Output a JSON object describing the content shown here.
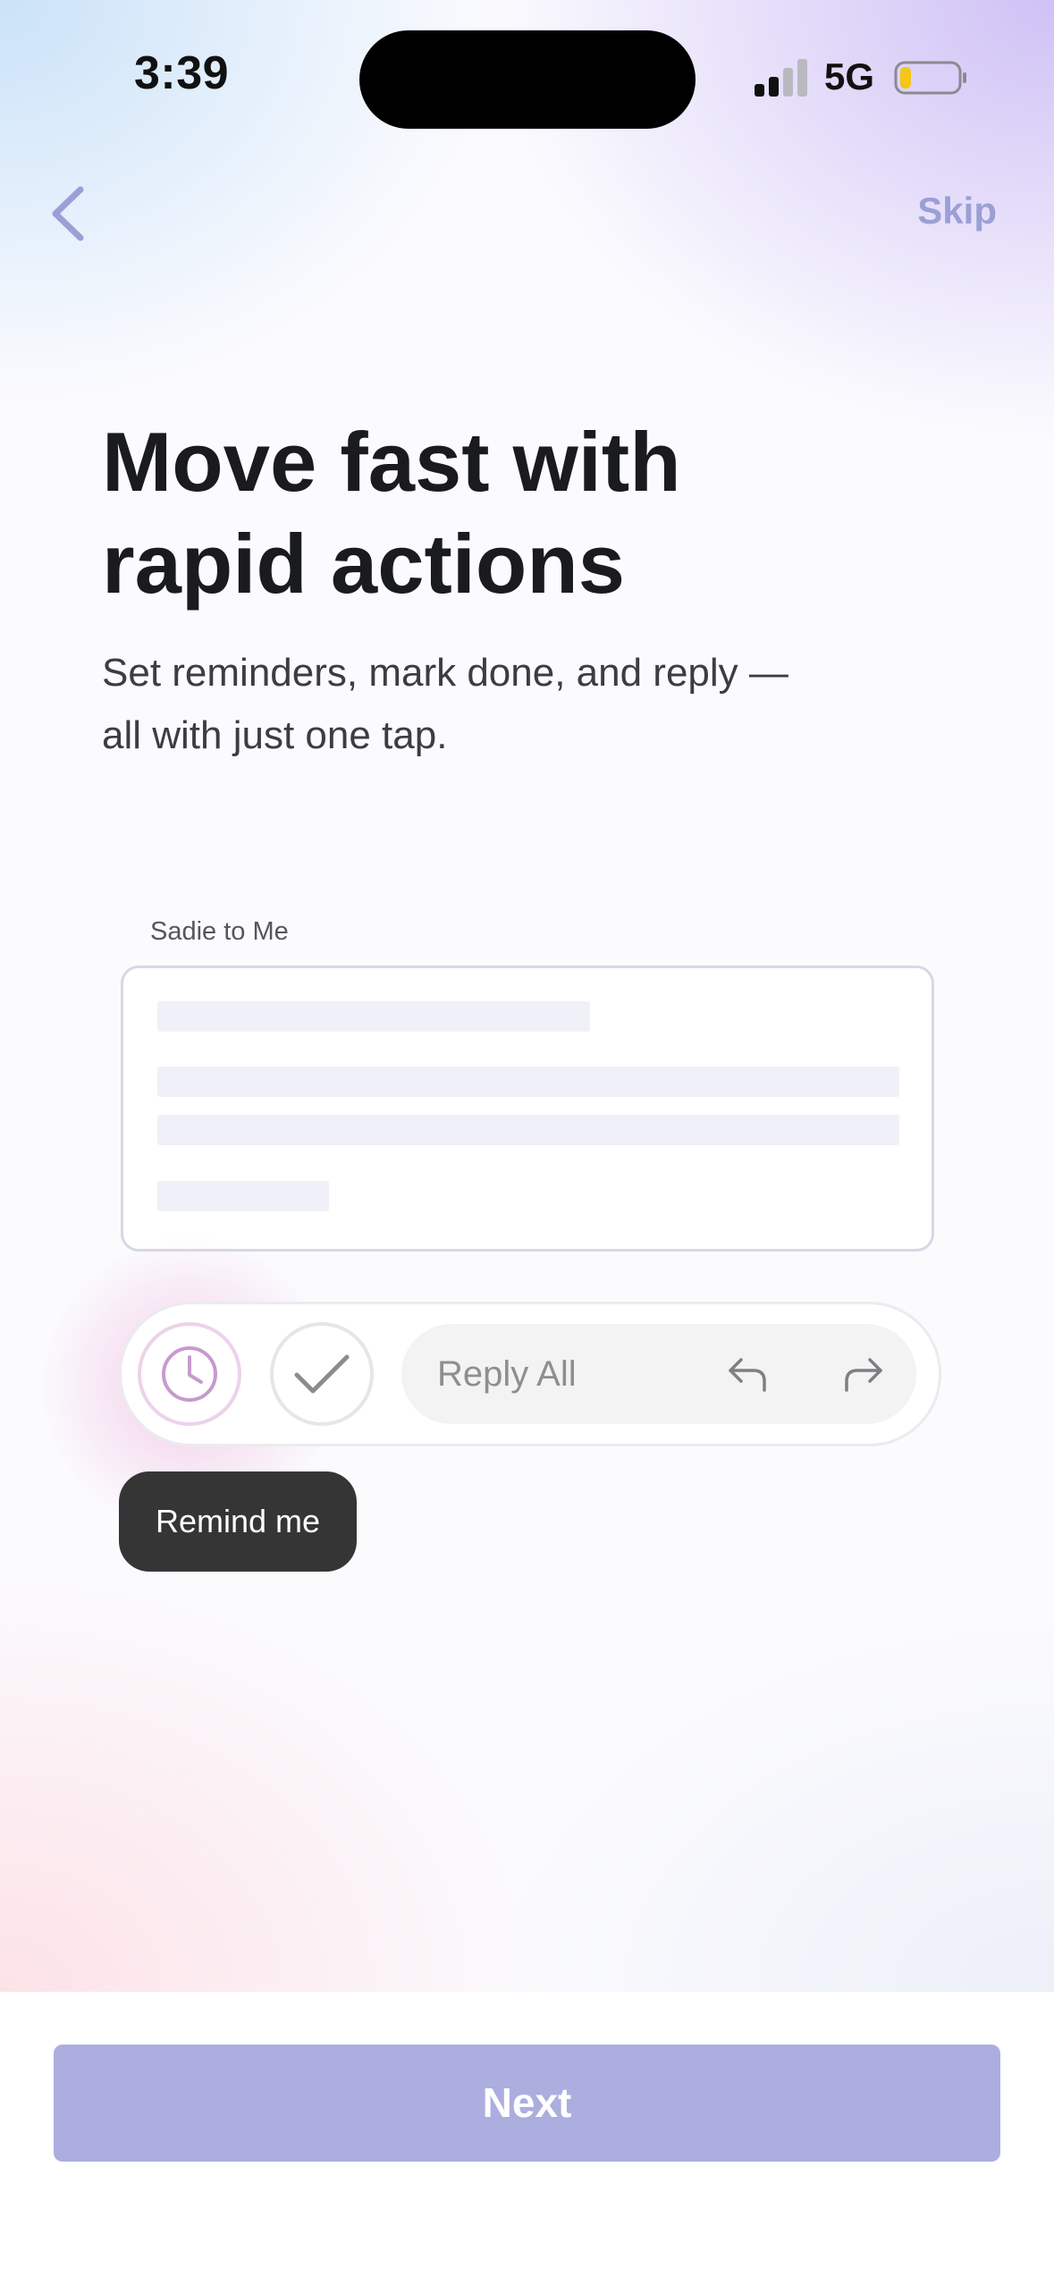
{
  "status_bar": {
    "time": "3:39",
    "network": "5G",
    "battery_level": 0.2,
    "battery_color": "#f5c518"
  },
  "nav": {
    "back_icon": "chevron-left-icon",
    "skip_label": "Skip"
  },
  "headline": {
    "line1": "Move fast with",
    "line2": "rapid actions"
  },
  "subtext": {
    "line1": "Set reminders, mark done, and reply —",
    "line2": "all with just one tap."
  },
  "email": {
    "from_label": "Sadie to Me"
  },
  "actions": {
    "remind_icon": "clock-icon",
    "done_icon": "checkmark-icon",
    "reply_all_label": "Reply All",
    "reply_icon": "reply-icon",
    "forward_icon": "forward-icon",
    "tooltip": "Remind me"
  },
  "footer": {
    "next_label": "Next"
  },
  "colors": {
    "accent": "#abaede",
    "skip": "#9a9fd6",
    "remind": "#c79ad0"
  }
}
